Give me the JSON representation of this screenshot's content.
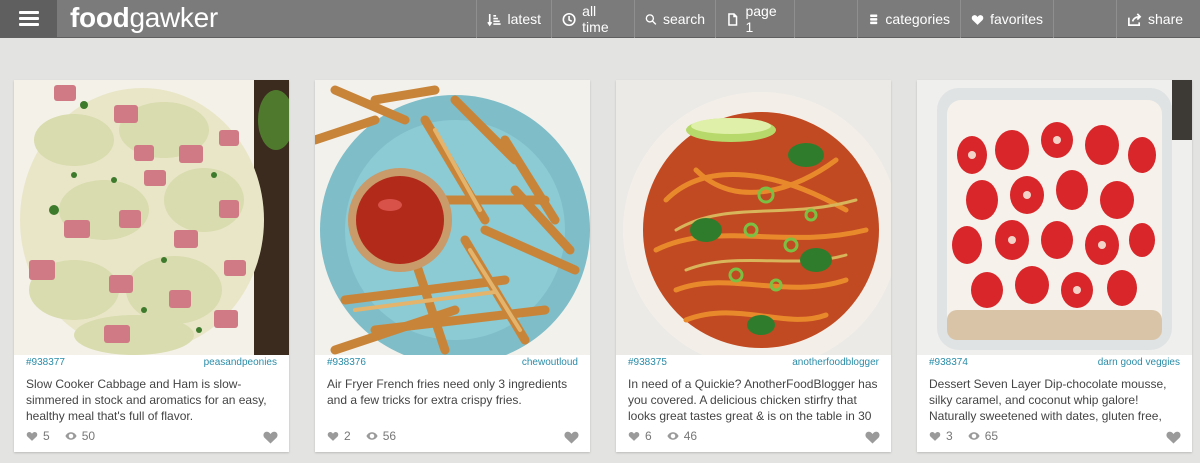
{
  "app": {
    "logo_bold": "food",
    "logo_light": "gawker"
  },
  "nav": {
    "latest": "latest",
    "all_time": "all time",
    "search": "search",
    "page": "page 1",
    "categories": "categories",
    "favorites": "favorites",
    "share": "share"
  },
  "icons": {
    "menu": "hamburger-icon",
    "latest": "sort-icon",
    "all_time": "clock-icon",
    "search": "search-icon",
    "page": "document-icon",
    "categories": "stack-icon",
    "favorites": "heart-icon",
    "share": "share-icon",
    "likes": "heart-icon",
    "views": "eye-icon"
  },
  "colors": {
    "topbar": "#7b7b7b",
    "background": "#e3e3e1",
    "link": "#2a8ca8"
  },
  "cards": [
    {
      "id": "#938377",
      "author": "peasandpeonies",
      "description": "Slow Cooker Cabbage and Ham is slow-simmered in stock and aromatics for an easy, healthy meal that's full of flavor.",
      "likes": "5",
      "views": "50"
    },
    {
      "id": "#938376",
      "author": "chewoutloud",
      "description": "Air Fryer French fries need only 3 ingredients and a few tricks for extra crispy fries.",
      "likes": "2",
      "views": "56"
    },
    {
      "id": "#938375",
      "author": "anotherfoodblogger",
      "description": "In need of a Quickie? AnotherFoodBlogger has you covered. A delicious chicken stirfry that looks great tastes great & is on the table in 30",
      "likes": "6",
      "views": "46"
    },
    {
      "id": "#938374",
      "author": "darn good veggies",
      "description": "Dessert Seven Layer Dip-chocolate mousse, silky caramel, and coconut whip galore! Naturally sweetened with dates, gluten free,",
      "likes": "3",
      "views": "65"
    }
  ]
}
